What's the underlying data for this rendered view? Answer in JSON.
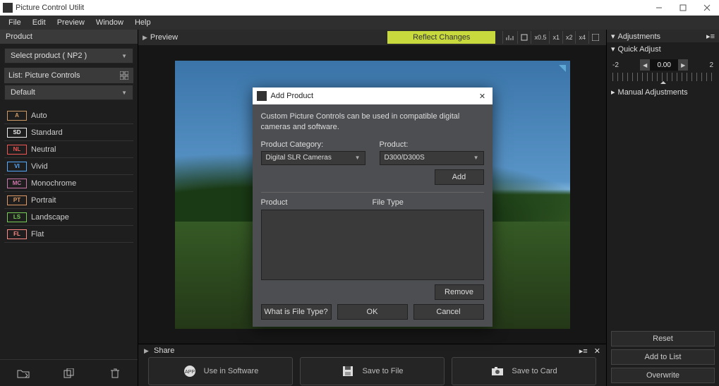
{
  "app_title": "Picture Control Utilit",
  "menus": [
    "File",
    "Edit",
    "Preview",
    "Window",
    "Help"
  ],
  "left": {
    "product_hdr": "Product",
    "product_sel": "Select product ( NP2 )",
    "list_hdr": "List: Picture Controls",
    "pc_sel": "Default",
    "pcs": [
      {
        "badge": "A",
        "cls": "au",
        "label": "Auto"
      },
      {
        "badge": "SD",
        "cls": "sd",
        "label": "Standard"
      },
      {
        "badge": "NL",
        "cls": "nl",
        "label": "Neutral"
      },
      {
        "badge": "VI",
        "cls": "vi",
        "label": "Vivid"
      },
      {
        "badge": "MC",
        "cls": "mc",
        "label": "Monochrome"
      },
      {
        "badge": "PT",
        "cls": "pt",
        "label": "Portrait"
      },
      {
        "badge": "LS",
        "cls": "ls",
        "label": "Landscape"
      },
      {
        "badge": "FL",
        "cls": "fl",
        "label": "Flat"
      }
    ]
  },
  "preview": {
    "hdr": "Preview",
    "reflect": "Reflect Changes",
    "zoom": [
      "x0.5",
      "x1",
      "x2",
      "x4"
    ]
  },
  "share": {
    "hdr": "Share",
    "btns": [
      {
        "icon": "app",
        "label": "Use in Software"
      },
      {
        "icon": "disk",
        "label": "Save to File"
      },
      {
        "icon": "card",
        "label": "Save to Card"
      }
    ]
  },
  "right": {
    "adj_hdr": "Adjustments",
    "quick_adj": "Quick Adjust",
    "qa_min": "-2",
    "qa_val": "0.00",
    "qa_max": "2",
    "manual": "Manual Adjustments",
    "reset": "Reset",
    "add": "Add to List",
    "over": "Overwrite"
  },
  "modal": {
    "title": "Add Product",
    "desc": "Custom Picture Controls can be used in compatible digital cameras and software.",
    "cat_label": "Product Category:",
    "cat_val": "Digital SLR Cameras",
    "prod_label": "Product:",
    "prod_val": "D300/D300S",
    "add": "Add",
    "tbl_prod": "Product",
    "tbl_ft": "File Type",
    "remove": "Remove",
    "what": "What is File Type?",
    "ok": "OK",
    "cancel": "Cancel"
  }
}
